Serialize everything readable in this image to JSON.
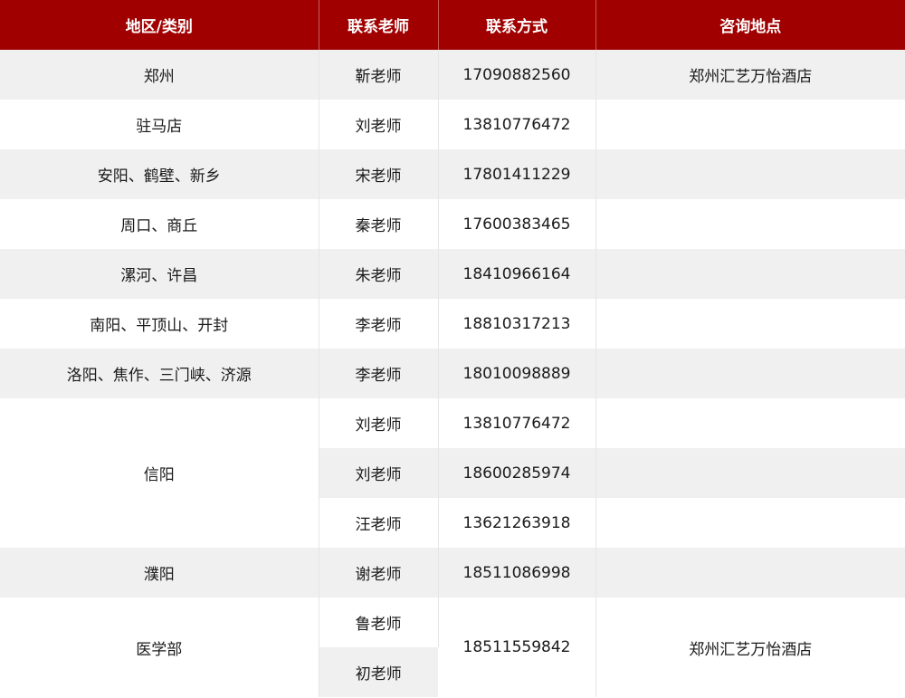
{
  "headers": [
    "地区/类别",
    "联系老师",
    "联系方式",
    "咨询地点"
  ],
  "rows": [
    {
      "region": "郑州",
      "teacher": "靳老师",
      "phone": "17090882560",
      "location": "郑州汇艺万怡酒店"
    },
    {
      "region": "驻马店",
      "teacher": "刘老师",
      "phone": "13810776472",
      "location": ""
    },
    {
      "region": "安阳、鹤壁、新乡",
      "teacher": "宋老师",
      "phone": "17801411229",
      "location": ""
    },
    {
      "region": "周口、商丘",
      "teacher": "秦老师",
      "phone": "17600383465",
      "location": ""
    },
    {
      "region": "漯河、许昌",
      "teacher": "朱老师",
      "phone": "18410966164",
      "location": ""
    },
    {
      "region": "南阳、平顶山、开封",
      "teacher": "李老师",
      "phone": "18810317213",
      "location": ""
    },
    {
      "region": "洛阳、焦作、三门峡、济源",
      "teacher": "李老师",
      "phone": "18010098889",
      "location": ""
    }
  ],
  "xinyang": {
    "region": "信阳",
    "entries": [
      {
        "teacher": "刘老师",
        "phone": "13810776472",
        "location": ""
      },
      {
        "teacher": "刘老师",
        "phone": "18600285974",
        "location": ""
      },
      {
        "teacher": "汪老师",
        "phone": "13621263918",
        "location": ""
      }
    ]
  },
  "puyang": {
    "region": "濮阳",
    "teacher": "谢老师",
    "phone": "18511086998",
    "location": ""
  },
  "medical": {
    "region": "医学部",
    "teachers": [
      "鲁老师",
      "初老师"
    ],
    "phone": "18511559842",
    "location": "郑州汇艺万怡酒店"
  }
}
